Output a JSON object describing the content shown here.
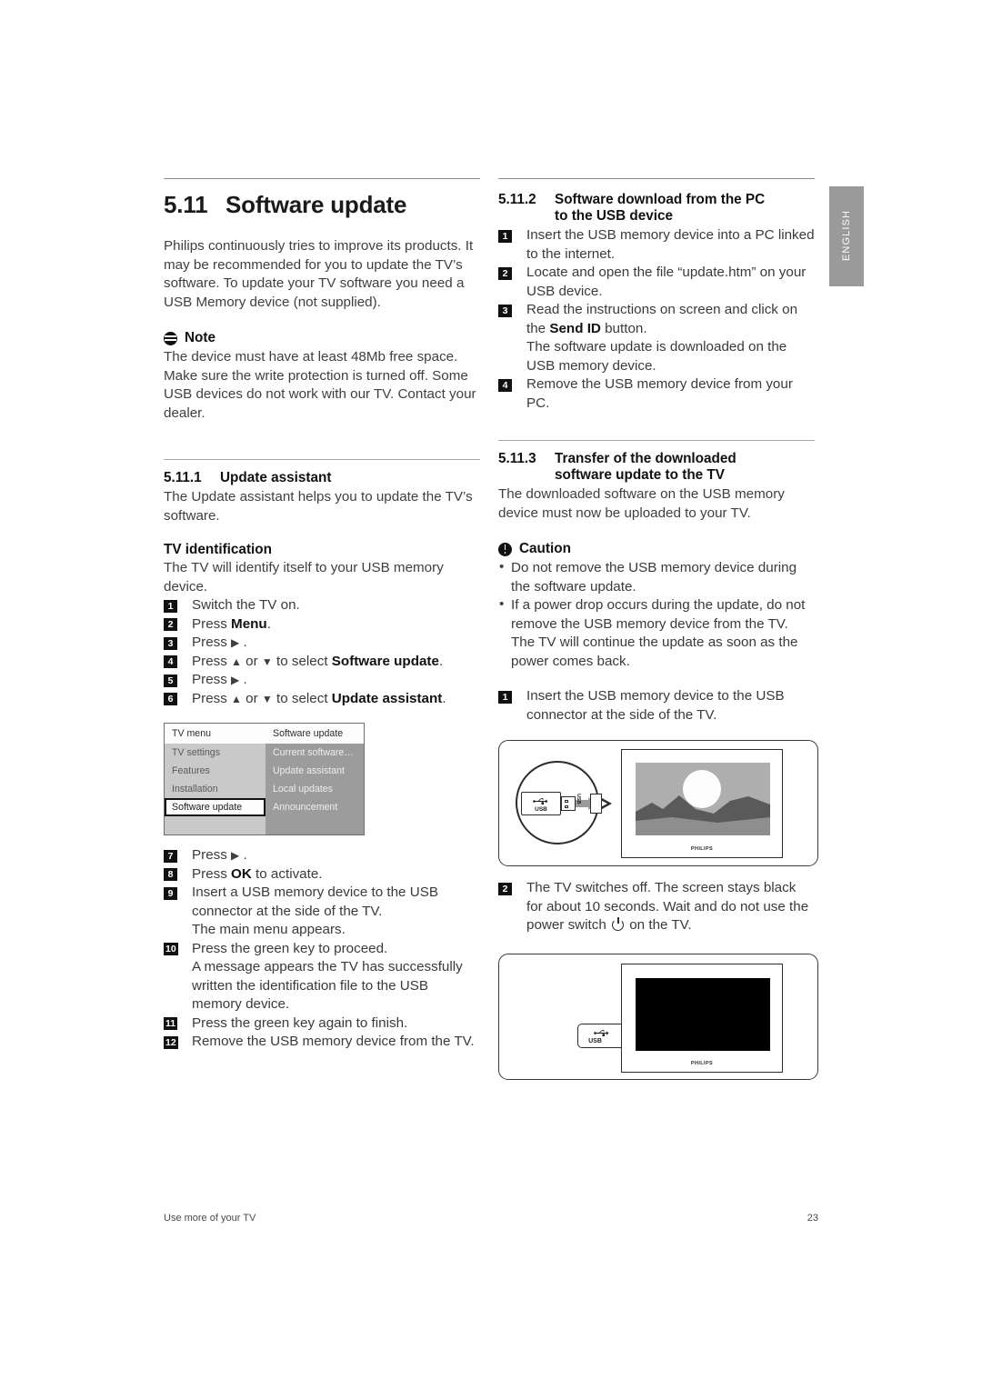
{
  "language_tab": {
    "label": "ENGLISH"
  },
  "left_column": {
    "chapter": {
      "number": "5.11",
      "title": "Software update"
    },
    "intro": "Philips continuously tries to improve its products. It may be recommended for you to update the TV’s software. To update your TV software you need a USB Memory device (not supplied).",
    "note": {
      "icon": "note-icon",
      "heading": "Note",
      "body": "The device must have at least 48Mb free space. Make sure the write protection is turned off. Some USB devices do not work with our TV. Contact your dealer."
    },
    "section_1": {
      "number": "5.11.1",
      "title": "Update assistant",
      "intro": "The Update assistant helps you to update the TV’s software.",
      "subheading": "TV identification",
      "subintro": "The TV will identify itself to your USB memory device.",
      "steps": [
        {
          "n": "1",
          "parts": [
            {
              "t": "Switch the TV on."
            }
          ]
        },
        {
          "n": "2",
          "parts": [
            {
              "t": "Press "
            },
            {
              "t": "Menu",
              "b": true
            },
            {
              "t": "."
            }
          ]
        },
        {
          "n": "3",
          "parts": [
            {
              "t": "Press "
            },
            {
              "t": "▶",
              "arrow": true
            },
            {
              "t": " ."
            }
          ]
        },
        {
          "n": "4",
          "parts": [
            {
              "t": "Press "
            },
            {
              "t": "▲",
              "arrow": true
            },
            {
              "t": " or "
            },
            {
              "t": "▼",
              "arrow": true
            },
            {
              "t": " to select "
            },
            {
              "t": "Software update",
              "b": true
            },
            {
              "t": "."
            }
          ]
        },
        {
          "n": "5",
          "parts": [
            {
              "t": "Press "
            },
            {
              "t": "▶",
              "arrow": true
            },
            {
              "t": " ."
            }
          ]
        },
        {
          "n": "6",
          "parts": [
            {
              "t": "Press "
            },
            {
              "t": "▲",
              "arrow": true
            },
            {
              "t": " or "
            },
            {
              "t": "▼",
              "arrow": true
            },
            {
              "t": " to select "
            },
            {
              "t": "Update assistant",
              "b": true
            },
            {
              "t": "."
            }
          ]
        }
      ],
      "steps_after_menu": [
        {
          "n": "7",
          "parts": [
            {
              "t": "Press "
            },
            {
              "t": "▶",
              "arrow": true
            },
            {
              "t": " ."
            }
          ]
        },
        {
          "n": "8",
          "parts": [
            {
              "t": "Press "
            },
            {
              "t": "OK",
              "b": true
            },
            {
              "t": " to activate."
            }
          ]
        },
        {
          "n": "9",
          "parts": [
            {
              "t": "Insert a USB memory device to the USB connector at the side of the TV."
            }
          ],
          "cont": "The main menu appears."
        },
        {
          "n": "10",
          "parts": [
            {
              "t": "Press the green key to proceed."
            }
          ],
          "cont": "A message appears the TV has successfully written the identification file to the USB memory device."
        },
        {
          "n": "11",
          "parts": [
            {
              "t": "Press the green key again to finish."
            }
          ]
        },
        {
          "n": "12",
          "parts": [
            {
              "t": "Remove the USB memory device from the TV."
            }
          ]
        }
      ]
    },
    "tv_menu": {
      "header": {
        "left": "TV menu",
        "right": "Software update"
      },
      "rows": [
        {
          "left": "TV settings",
          "right": "Current software…",
          "selected": false
        },
        {
          "left": "Features",
          "right": "Update assistant",
          "selected": false
        },
        {
          "left": "Installation",
          "right": "Local updates",
          "selected": false
        },
        {
          "left": "Software update",
          "right": "Announcement",
          "selected": true
        },
        {
          "left": "",
          "right": "",
          "selected": false
        }
      ]
    }
  },
  "right_column": {
    "section_2": {
      "number": "5.11.2",
      "title_line1": "Software download from the PC",
      "title_line2": "to the USB device",
      "steps": [
        {
          "n": "1",
          "parts": [
            {
              "t": "Insert the USB memory device into a PC linked to the internet."
            }
          ]
        },
        {
          "n": "2",
          "parts": [
            {
              "t": "Locate and open the file “update.htm” on your USB device."
            }
          ]
        },
        {
          "n": "3",
          "parts": [
            {
              "t": "Read the instructions on screen and click on the "
            },
            {
              "t": "Send ID",
              "b": true
            },
            {
              "t": " button."
            }
          ],
          "cont": "The software update is downloaded on the USB memory device."
        },
        {
          "n": "4",
          "parts": [
            {
              "t": "Remove the USB memory device from your PC."
            }
          ]
        }
      ]
    },
    "section_3": {
      "number": "5.11.3",
      "title_line1": "Transfer of the downloaded",
      "title_line2": "software update to the TV",
      "intro": "The downloaded software on the USB memory device must now be uploaded to your TV.",
      "caution": {
        "icon": "caution-icon",
        "heading": "Caution",
        "bullets": [
          "Do not remove the USB memory device during the software update.",
          "If a power drop occurs during the update, do not remove the USB memory device from the TV. The TV will continue the update as soon as the power comes back."
        ]
      },
      "step_1": {
        "n": "1",
        "text": "Insert the USB memory device to the USB connector at the side of the TV."
      },
      "step_2": {
        "n": "2",
        "part_a": "The TV switches off. The screen stays black for about 10 seconds. Wait and do not use the power switch ",
        "part_b": " on the TV.",
        "power_icon": "power-icon"
      }
    },
    "illustration_1": {
      "name": "tv-usb-insert-illustration",
      "usb_label": "USB",
      "usb_port_label": "USB",
      "tv_brand": "PHILIPS"
    },
    "illustration_2": {
      "name": "tv-black-screen-illustration",
      "usb_label": "USB",
      "tv_brand": "PHILIPS"
    }
  },
  "footer": {
    "left": "Use more of your TV",
    "page_number": "23"
  }
}
